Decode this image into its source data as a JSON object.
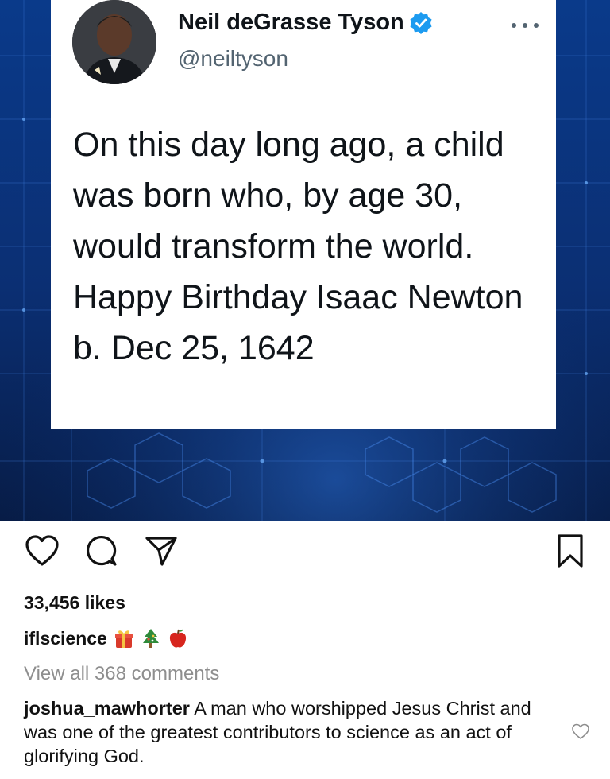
{
  "tweet": {
    "display_name": "Neil deGrasse Tyson",
    "handle": "@neiltyson",
    "text": "On this day long ago, a child was born who, by age 30, would transform the world. Happy Birthday Isaac Newton b. Dec 25, 1642",
    "verified_icon": "verified-badge-icon",
    "more_icon": "more-options-icon"
  },
  "post": {
    "likes": "33,456 likes",
    "caption_user": "iflscience",
    "caption_emojis": [
      "gift-emoji",
      "christmas-tree-emoji",
      "red-apple-emoji"
    ],
    "view_comments": "View all 368 comments",
    "comment": {
      "user": "joshua_mawhorter",
      "text": "A man who worshipped Jesus Christ and was one of the greatest contributors to science as an act of glorifying God."
    },
    "action_icons": [
      "heart-icon",
      "comment-icon",
      "share-icon",
      "bookmark-icon"
    ]
  },
  "colors": {
    "background_blue": "#0b2f73",
    "verified_blue": "#1d9bf0",
    "muted_gray": "#8e8e8e",
    "handle_gray": "#536471"
  }
}
